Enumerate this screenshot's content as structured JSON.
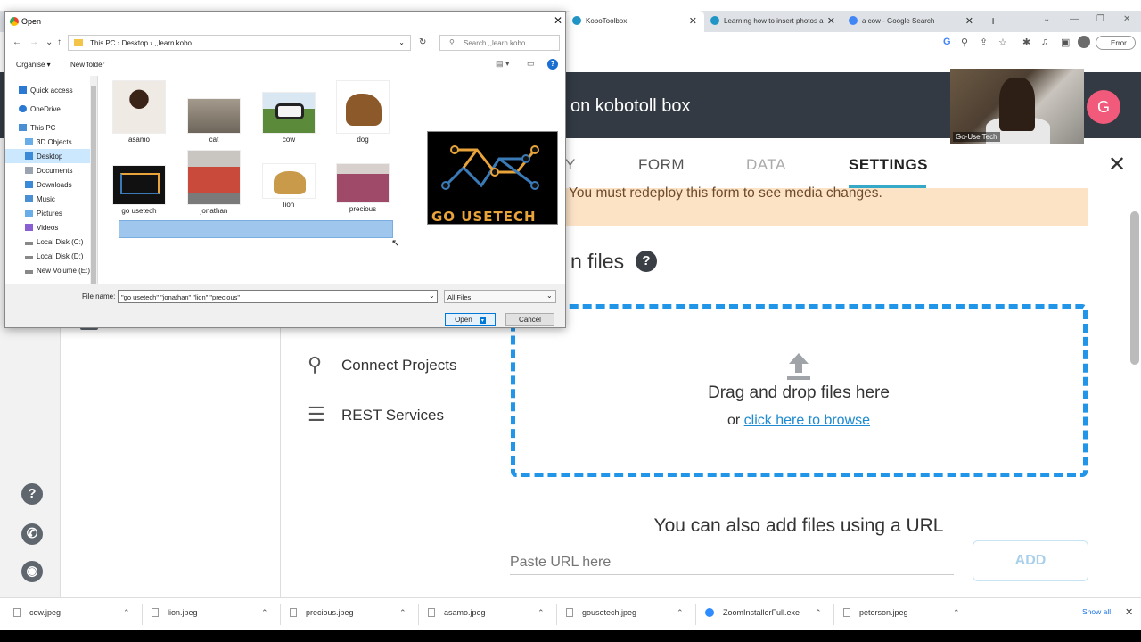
{
  "browser": {
    "tabs": [
      {
        "label": "KoboToolbox",
        "favicon_color": "#2095c6"
      },
      {
        "label": "Learning how to insert photos a",
        "favicon_color": "#2095c6"
      },
      {
        "label": "a cow - Google Search",
        "favicon_color": "#4285f4"
      }
    ],
    "new_tab": "+",
    "profile_badge": "Error"
  },
  "kobo": {
    "project_title": "on kobotoll box",
    "avatar_letter": "G",
    "tabs": {
      "summary_partial": "Y",
      "form": "FORM",
      "data": "DATA",
      "settings": "SETTINGS"
    },
    "close_glyph": "✕",
    "banner": "You must redeploy this form to see media changes.",
    "section_title": "n files",
    "help_glyph": "?",
    "dropzone": {
      "main": "Drag and drop files here",
      "or": "or ",
      "browse": "click here to browse"
    },
    "url_heading": "You can also add files using a URL",
    "url_placeholder": "Paste URL here",
    "add_button": "ADD",
    "side_links": {
      "connect": "Connect Projects",
      "rest": "REST Services"
    },
    "accent_color": "#2196e9"
  },
  "webcam": {
    "label": "Go-Use Tech"
  },
  "dialog": {
    "title": "Open",
    "address": [
      "This PC",
      "›",
      "Desktop",
      "›",
      ",,learn kobo"
    ],
    "search_placeholder": "Search ,,learn kobo",
    "organise": "Organise ▾",
    "new_folder": "New folder",
    "nav_items": [
      {
        "label": "Quick access",
        "color": "#2b79d3"
      },
      {
        "label": "OneDrive",
        "color": "#2b79d3"
      },
      {
        "label": "This PC",
        "color": "#4a8fd4"
      },
      {
        "label": "3D Objects",
        "color": "#6aaee9"
      },
      {
        "label": "Desktop",
        "color": "#3b8ad8",
        "selected": true
      },
      {
        "label": "Documents",
        "color": "#9aa4b0"
      },
      {
        "label": "Downloads",
        "color": "#3b8ad8"
      },
      {
        "label": "Music",
        "color": "#4a8fd4"
      },
      {
        "label": "Pictures",
        "color": "#6aaee9"
      },
      {
        "label": "Videos",
        "color": "#8a5fd4"
      },
      {
        "label": "Local Disk (C:)",
        "color": "#888"
      },
      {
        "label": "Local Disk (D:)",
        "color": "#888"
      },
      {
        "label": "New Volume (E:)",
        "color": "#888"
      }
    ],
    "files": [
      {
        "name": "asamo",
        "color": "#e9e3da"
      },
      {
        "name": "cat",
        "color": "#8b8478"
      },
      {
        "name": "cow",
        "color": "#5a8a3a"
      },
      {
        "name": "dog",
        "color": "#b07a3a"
      },
      {
        "name": "go usetech",
        "color": "#111"
      },
      {
        "name": "jonathan",
        "color": "#c94a3a"
      },
      {
        "name": "lion",
        "color": "#c99a4a"
      },
      {
        "name": "precious",
        "color": "#a04a6a"
      }
    ],
    "preview_text": "GO USETECH",
    "file_name_label": "File name:",
    "file_name_value": "\"go usetech\" \"jonathan\" \"lion\" \"precious\"",
    "file_type": "All Files",
    "open_button": "Open",
    "cancel_button": "Cancel",
    "close_glyph": "✕"
  },
  "downloads": {
    "items": [
      "cow.jpeg",
      "lion.jpeg",
      "precious.jpeg",
      "asamo.jpeg",
      "gousetech.jpeg",
      "ZoomInstallerFull.exe",
      "peterson.jpeg"
    ],
    "show_all": "Show all",
    "close_glyph": "✕"
  }
}
